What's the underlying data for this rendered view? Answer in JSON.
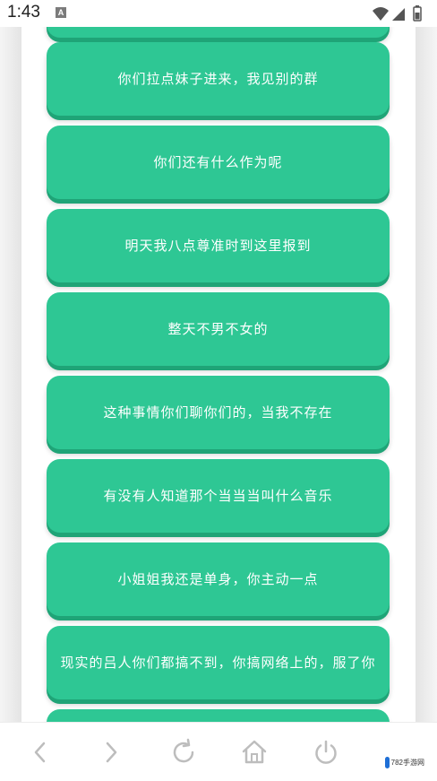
{
  "status_bar": {
    "time": "1:43",
    "notification_badge": "A"
  },
  "messages": [
    "",
    "你们拉点妹子进来，我见别的群",
    "你们还有什么作为呢",
    "明天我八点尊准时到这里报到",
    "整天不男不女的",
    "这种事情你们聊你们的，当我不存在",
    "有没有人知道那个当当当叫什么音乐",
    "小姐姐我还是单身，你主动一点",
    "现实的吕人你们都搞不到，你搞网络上的，服了你",
    ""
  ],
  "nav_bar": {
    "back_icon": "chevron-left-icon",
    "forward_icon": "chevron-right-icon",
    "refresh_icon": "refresh-icon",
    "home_icon": "home-icon",
    "power_icon": "power-icon",
    "watermark_text": "782手游网"
  },
  "colors": {
    "card": "#2ec794",
    "card_shadow": "#1fa477",
    "text": "#ffffff",
    "nav_icon": "#bdbdbd"
  }
}
